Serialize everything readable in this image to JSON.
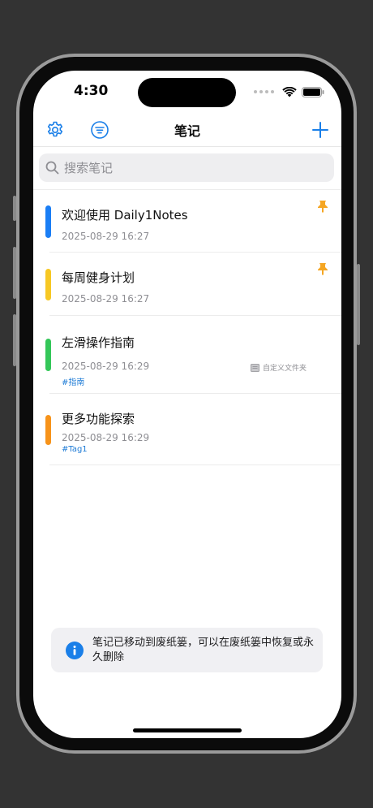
{
  "status": {
    "time": "4:30"
  },
  "nav": {
    "title": "笔记",
    "settings_icon": "gear-icon",
    "filter_icon": "filter-icon",
    "add_icon": "plus-icon"
  },
  "search": {
    "placeholder": "搜索笔记"
  },
  "colors": {
    "accent": "#1a7fe8",
    "pin": "#f5a623"
  },
  "notes": [
    {
      "title": "欢迎使用 Daily1Notes",
      "date": "2025-08-29 16:27",
      "color": "#1a7ef5",
      "pinned": true
    },
    {
      "title": "每周健身计划",
      "date": "2025-08-29 16:27",
      "color": "#f7c824",
      "pinned": true
    },
    {
      "title": "左滑操作指南",
      "date": "2025-08-29 16:29",
      "tag": "#指南",
      "folder": "自定义文件夹",
      "color": "#34c759",
      "pinned": false
    },
    {
      "title": "更多功能探索",
      "date": "2025-08-29 16:29",
      "tag": "#Tag1",
      "color": "#f7931a",
      "pinned": false
    }
  ],
  "toast": {
    "message": "笔记已移动到废纸篓，可以在废纸篓中恢复或永久删除",
    "icon": "info-icon"
  }
}
